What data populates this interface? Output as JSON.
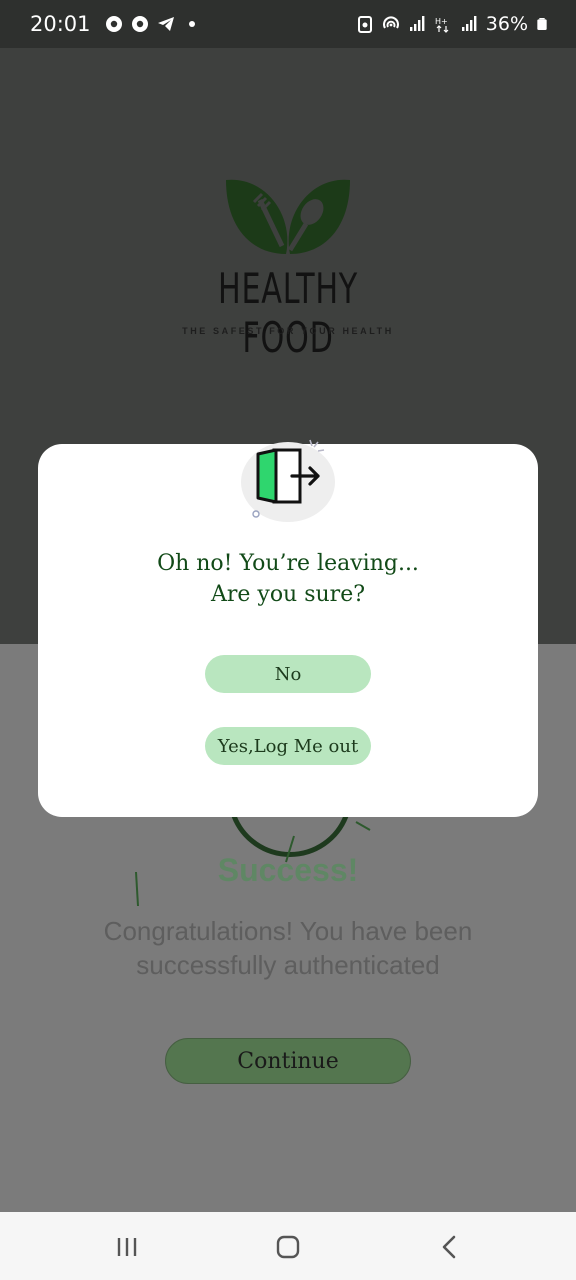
{
  "status_bar": {
    "time": "20:01",
    "battery_percent": "36%",
    "left_icons": [
      "chrome-icon",
      "chrome-icon",
      "telegram-icon",
      "dot-icon"
    ],
    "right_icons": [
      "battery-saver-icon",
      "hotspot-icon",
      "signal-icon",
      "hplus-data-icon",
      "signal-icon",
      "battery-icon"
    ]
  },
  "logo": {
    "title": "HEALTHY FOOD",
    "subtitle": "THE SAFEST FOR YOUR HEALTH"
  },
  "background_screen": {
    "success_title": "Success!",
    "success_message": "Congratulations! You have been successfully authenticated",
    "continue_label": "Continue"
  },
  "dialog": {
    "icon": "logout-door-icon",
    "title_line1": "Oh no! You’re leaving...",
    "title_line2": "Are you sure?",
    "no_label": "No",
    "yes_label": "Yes,Log Me out"
  },
  "colors": {
    "accent_green": "#b9e6bf",
    "title_green": "#124a18",
    "door_green": "#2fd66e"
  },
  "nav_bar": {
    "icons": [
      "recent-apps-icon",
      "home-icon",
      "back-icon"
    ]
  }
}
